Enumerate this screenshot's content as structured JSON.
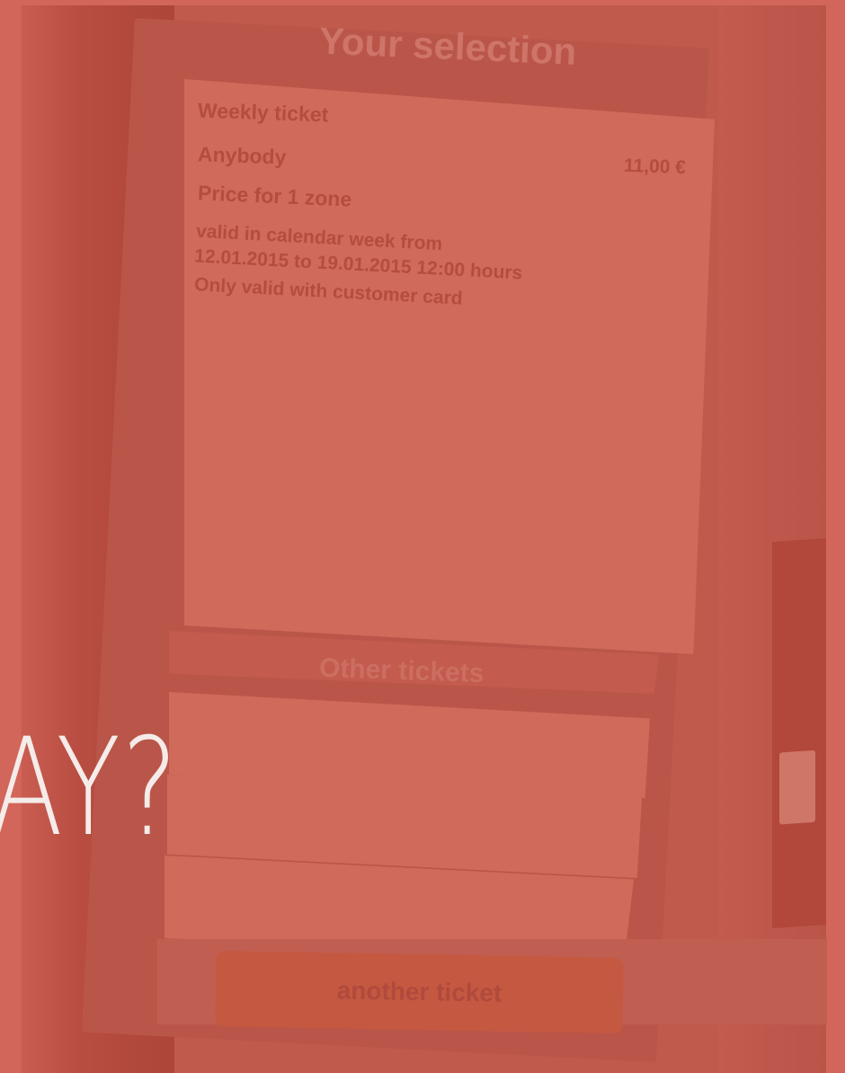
{
  "selection": {
    "title": "Your selection",
    "ticket_type": "Weekly ticket",
    "passenger": "Anybody",
    "price": "11,00 €",
    "zone": "Price for 1 zone",
    "validity_line1": "valid in calendar week from",
    "validity_line2": "12.01.2015 to 19.01.2015 12:00 hours",
    "validity_line3": "Only valid with customer card"
  },
  "other": {
    "label": "Other tickets"
  },
  "actions": {
    "another_ticket": "another ticket"
  },
  "overlay": {
    "text": "AY?"
  },
  "colors": {
    "overlay_tint": "#d2665a",
    "overlay_text": "#f5ece9"
  }
}
